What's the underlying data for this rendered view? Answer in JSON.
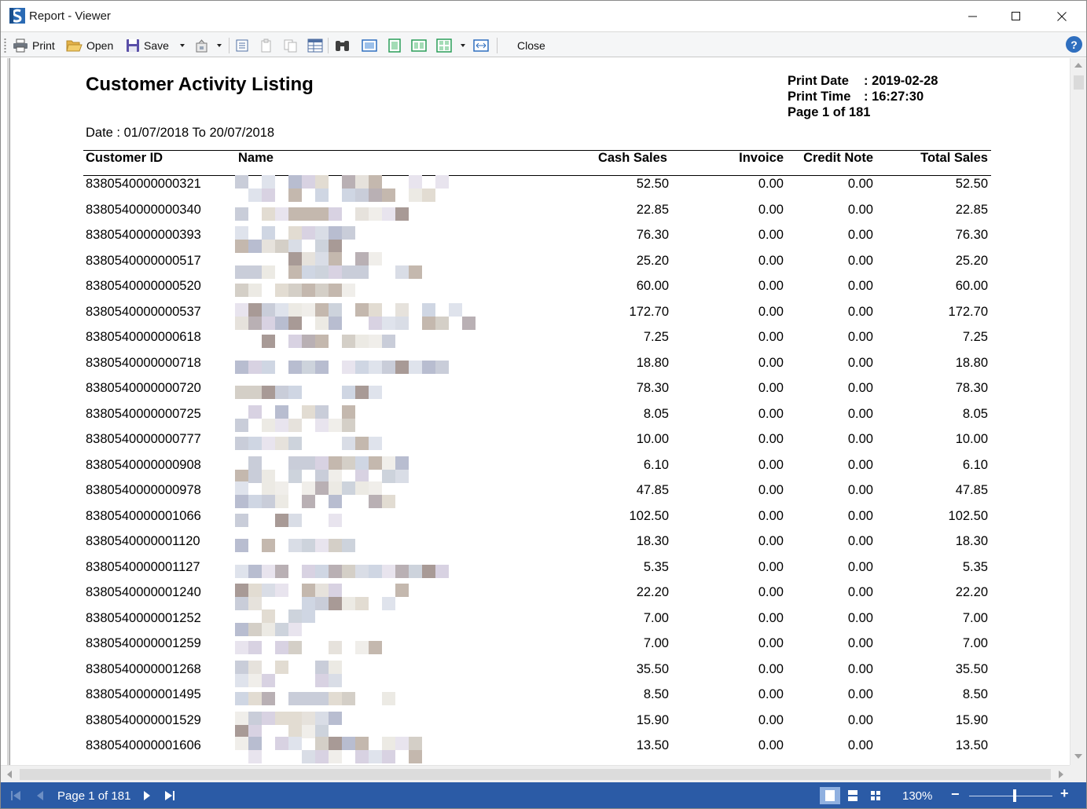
{
  "window": {
    "title": "Report - Viewer",
    "controls": {
      "minimize": "—",
      "maximize": "☐",
      "close": "✕"
    }
  },
  "toolbar": {
    "print_label": "Print",
    "open_label": "Open",
    "save_label": "Save",
    "close_label": "Close",
    "icons": [
      "printer-icon",
      "folder-open-icon",
      "floppy-disk-icon",
      "export-icon",
      "parameters-icon",
      "copy-icon",
      "paste-icon",
      "table-icon",
      "binoculars-icon",
      "page-view-icon",
      "page-width-icon",
      "two-pages-icon",
      "multi-page-icon",
      "full-screen-icon",
      "help-icon"
    ]
  },
  "report": {
    "title": "Customer Activity Listing",
    "print_date_label": "Print Date",
    "print_date_value": ": 2019-02-28",
    "print_time_label": "Print Time",
    "print_time_value": ": 16:27:30",
    "page_label": "Page 1 of 181",
    "date_range": "Date : 01/07/2018 To 20/07/2018",
    "columns": [
      "Customer ID",
      "Name",
      "Cash Sales",
      "Invoice",
      "Credit Note",
      "Total Sales"
    ],
    "rows": [
      {
        "id": "8380540000000321",
        "cash": "52.50",
        "invoice": "0.00",
        "credit": "0.00",
        "total": "52.50"
      },
      {
        "id": "8380540000000340",
        "cash": "22.85",
        "invoice": "0.00",
        "credit": "0.00",
        "total": "22.85"
      },
      {
        "id": "8380540000000393",
        "cash": "76.30",
        "invoice": "0.00",
        "credit": "0.00",
        "total": "76.30"
      },
      {
        "id": "8380540000000517",
        "cash": "25.20",
        "invoice": "0.00",
        "credit": "0.00",
        "total": "25.20"
      },
      {
        "id": "8380540000000520",
        "cash": "60.00",
        "invoice": "0.00",
        "credit": "0.00",
        "total": "60.00"
      },
      {
        "id": "8380540000000537",
        "cash": "172.70",
        "invoice": "0.00",
        "credit": "0.00",
        "total": "172.70"
      },
      {
        "id": "8380540000000618",
        "cash": "7.25",
        "invoice": "0.00",
        "credit": "0.00",
        "total": "7.25"
      },
      {
        "id": "8380540000000718",
        "cash": "18.80",
        "invoice": "0.00",
        "credit": "0.00",
        "total": "18.80"
      },
      {
        "id": "8380540000000720",
        "cash": "78.30",
        "invoice": "0.00",
        "credit": "0.00",
        "total": "78.30"
      },
      {
        "id": "8380540000000725",
        "cash": "8.05",
        "invoice": "0.00",
        "credit": "0.00",
        "total": "8.05"
      },
      {
        "id": "8380540000000777",
        "cash": "10.00",
        "invoice": "0.00",
        "credit": "0.00",
        "total": "10.00"
      },
      {
        "id": "8380540000000908",
        "cash": "6.10",
        "invoice": "0.00",
        "credit": "0.00",
        "total": "6.10"
      },
      {
        "id": "8380540000000978",
        "cash": "47.85",
        "invoice": "0.00",
        "credit": "0.00",
        "total": "47.85"
      },
      {
        "id": "8380540000001066",
        "cash": "102.50",
        "invoice": "0.00",
        "credit": "0.00",
        "total": "102.50"
      },
      {
        "id": "8380540000001120",
        "cash": "18.30",
        "invoice": "0.00",
        "credit": "0.00",
        "total": "18.30"
      },
      {
        "id": "8380540000001127",
        "cash": "5.35",
        "invoice": "0.00",
        "credit": "0.00",
        "total": "5.35"
      },
      {
        "id": "8380540000001240",
        "cash": "22.20",
        "invoice": "0.00",
        "credit": "0.00",
        "total": "22.20"
      },
      {
        "id": "8380540000001252",
        "cash": "7.00",
        "invoice": "0.00",
        "credit": "0.00",
        "total": "7.00"
      },
      {
        "id": "8380540000001259",
        "cash": "7.00",
        "invoice": "0.00",
        "credit": "0.00",
        "total": "7.00"
      },
      {
        "id": "8380540000001268",
        "cash": "35.50",
        "invoice": "0.00",
        "credit": "0.00",
        "total": "35.50"
      },
      {
        "id": "8380540000001495",
        "cash": "8.50",
        "invoice": "0.00",
        "credit": "0.00",
        "total": "8.50"
      },
      {
        "id": "8380540000001529",
        "cash": "15.90",
        "invoice": "0.00",
        "credit": "0.00",
        "total": "15.90"
      },
      {
        "id": "8380540000001606",
        "cash": "13.50",
        "invoice": "0.00",
        "credit": "0.00",
        "total": "13.50"
      }
    ]
  },
  "statusbar": {
    "page_text": "Page 1 of 181",
    "zoom_text": "130%",
    "zoom_minus": "−",
    "zoom_plus": "+",
    "zoom_level_percent": 130
  },
  "colors": {
    "statusbar_bg": "#2b5ba6",
    "active_view_bg": "#8fb0e0",
    "help_bg": "#2f6fbf"
  }
}
